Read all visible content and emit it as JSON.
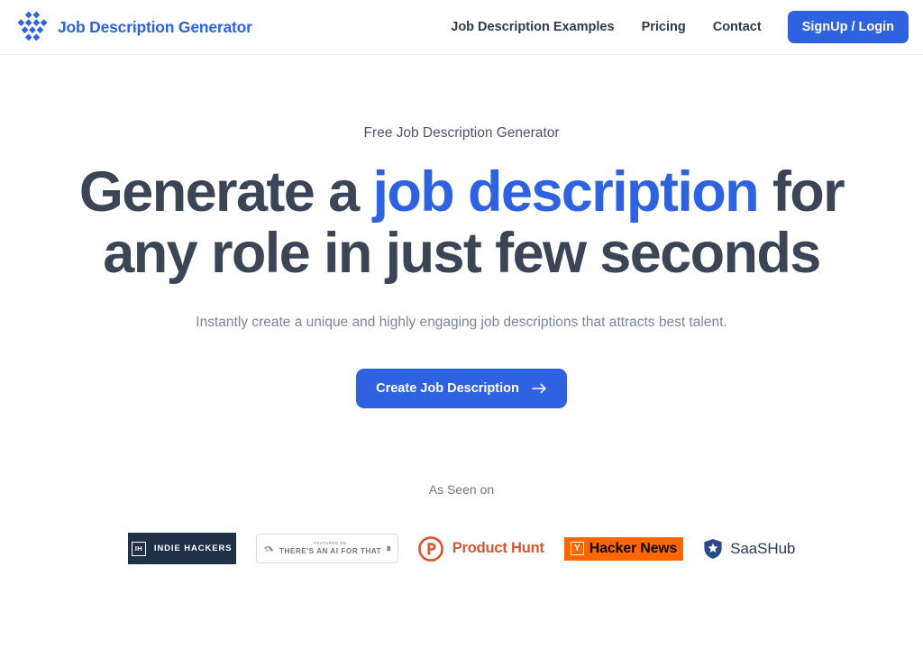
{
  "header": {
    "brand": {
      "icon": "pinwheel-blocks-logo-icon",
      "name": "Job Description Generator",
      "color": "#2f62e0"
    },
    "nav_links": [
      {
        "label": "Job Description Examples"
      },
      {
        "label": "Pricing"
      },
      {
        "label": "Contact"
      }
    ],
    "cta": {
      "label": "SignUp / Login",
      "bg": "#2f62e0",
      "color": "#ffffff"
    }
  },
  "hero": {
    "eyebrow": "Free Job Description Generator",
    "headline": {
      "part1": "Generate a ",
      "accent": "job description",
      "part2": " for any role in just few seconds",
      "accent_color": "#2f62e0",
      "base_color": "#3b4556"
    },
    "subhead": "Instantly create a unique and highly engaging job descriptions that attracts best talent.",
    "cta": {
      "label": "Create Job Description",
      "icon": "arrow-right-icon",
      "bg": "#2f62e0",
      "color": "#ffffff"
    }
  },
  "social_proof": {
    "label": "As Seen on",
    "logos": [
      {
        "id": "indie-hackers",
        "mark": "IH",
        "name": "INDIE HACKERS",
        "bg": "#1f3047",
        "color": "#ffffff"
      },
      {
        "id": "theres-an-ai-for-that",
        "kicker": "FEATURED ON",
        "name": "THERE'S AN AI FOR THAT",
        "color": "#6f7785",
        "left_icon": "flexed-bicep-icon",
        "right_icon": "bookmark-icon"
      },
      {
        "id": "product-hunt",
        "mark": "P",
        "name": "Product Hunt",
        "color": "#da552f"
      },
      {
        "id": "hacker-news",
        "mark": "Y",
        "name": "Hacker News",
        "bg": "#ff6600",
        "color": "#0a0a0a"
      },
      {
        "id": "saashub",
        "name": "SaaSHub",
        "color": "#2b3b57",
        "icon": "shield-star-icon"
      }
    ]
  }
}
